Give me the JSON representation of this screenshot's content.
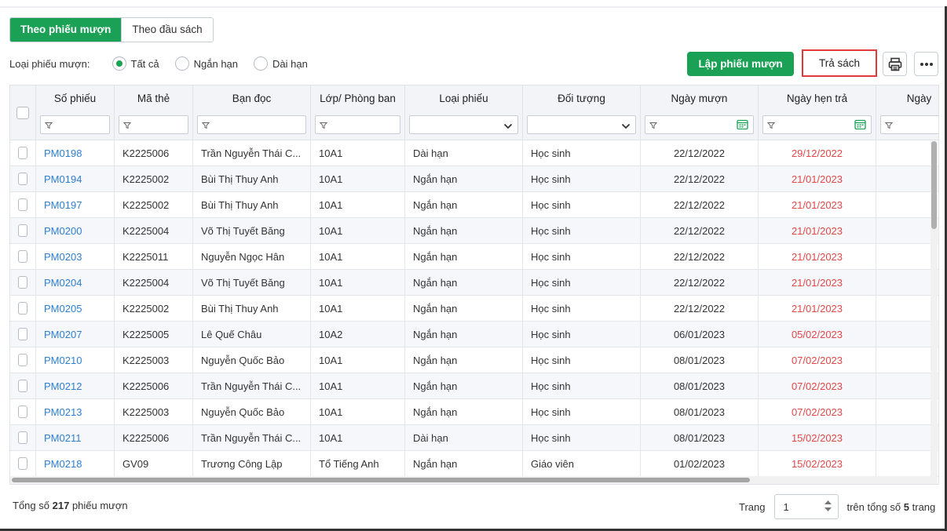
{
  "tabs": [
    {
      "label": "Theo phiếu mượn",
      "active": true
    },
    {
      "label": "Theo đầu sách",
      "active": false
    }
  ],
  "filter": {
    "label": "Loại phiếu mượn:",
    "options": [
      {
        "label": "Tất cả",
        "checked": true
      },
      {
        "label": "Ngắn hạn",
        "checked": false
      },
      {
        "label": "Dài hạn",
        "checked": false
      }
    ]
  },
  "toolbar": {
    "create_label": "Lập phiếu mượn",
    "return_label": "Trả sách",
    "print_icon": "printer-icon",
    "more_icon": "more-icon"
  },
  "colors": {
    "primary": "#1aa155",
    "link": "#2d7fd3",
    "due": "#e04848",
    "highlight": "#e03b3b"
  },
  "table": {
    "columns": [
      {
        "key": "select",
        "label": ""
      },
      {
        "key": "so_phieu",
        "label": "Số phiếu",
        "filter": "text"
      },
      {
        "key": "ma_the",
        "label": "Mã thẻ",
        "filter": "text"
      },
      {
        "key": "ban_doc",
        "label": "Bạn đọc",
        "filter": "text"
      },
      {
        "key": "lop",
        "label": "Lớp/ Phòng ban",
        "filter": "text"
      },
      {
        "key": "loai_phieu",
        "label": "Loại phiếu",
        "filter": "select"
      },
      {
        "key": "doi_tuong",
        "label": "Đối tượng",
        "filter": "select"
      },
      {
        "key": "ngay_muon",
        "label": "Ngày mượn",
        "filter": "date"
      },
      {
        "key": "ngay_hen_tra",
        "label": "Ngày hẹn trả",
        "filter": "date"
      },
      {
        "key": "ngay_tra",
        "label": "Ngày",
        "filter": "text"
      }
    ],
    "rows": [
      {
        "so_phieu": "PM0198",
        "ma_the": "K2225006",
        "ban_doc": "Trần Nguyễn Thái C...",
        "lop": "10A1",
        "loai_phieu": "Dài hạn",
        "doi_tuong": "Học sinh",
        "ngay_muon": "22/12/2022",
        "ngay_hen_tra": "29/12/2022"
      },
      {
        "so_phieu": "PM0194",
        "ma_the": "K2225002",
        "ban_doc": "Bùi Thị Thuy Anh",
        "lop": "10A1",
        "loai_phieu": "Ngắn hạn",
        "doi_tuong": "Học sinh",
        "ngay_muon": "22/12/2022",
        "ngay_hen_tra": "21/01/2023"
      },
      {
        "so_phieu": "PM0197",
        "ma_the": "K2225002",
        "ban_doc": "Bùi Thị Thuy Anh",
        "lop": "10A1",
        "loai_phieu": "Ngắn hạn",
        "doi_tuong": "Học sinh",
        "ngay_muon": "22/12/2022",
        "ngay_hen_tra": "21/01/2023"
      },
      {
        "so_phieu": "PM0200",
        "ma_the": "K2225004",
        "ban_doc": "Võ Thị Tuyết Băng",
        "lop": "10A1",
        "loai_phieu": "Ngắn hạn",
        "doi_tuong": "Học sinh",
        "ngay_muon": "22/12/2022",
        "ngay_hen_tra": "21/01/2023"
      },
      {
        "so_phieu": "PM0203",
        "ma_the": "K2225011",
        "ban_doc": "Nguyễn Ngọc Hân",
        "lop": "10A1",
        "loai_phieu": "Ngắn hạn",
        "doi_tuong": "Học sinh",
        "ngay_muon": "22/12/2022",
        "ngay_hen_tra": "21/01/2023"
      },
      {
        "so_phieu": "PM0204",
        "ma_the": "K2225004",
        "ban_doc": "Võ Thị Tuyết Băng",
        "lop": "10A1",
        "loai_phieu": "Ngắn hạn",
        "doi_tuong": "Học sinh",
        "ngay_muon": "22/12/2022",
        "ngay_hen_tra": "21/01/2023"
      },
      {
        "so_phieu": "PM0205",
        "ma_the": "K2225002",
        "ban_doc": "Bùi Thị Thuy Anh",
        "lop": "10A1",
        "loai_phieu": "Ngắn hạn",
        "doi_tuong": "Học sinh",
        "ngay_muon": "22/12/2022",
        "ngay_hen_tra": "21/01/2023"
      },
      {
        "so_phieu": "PM0207",
        "ma_the": "K2225005",
        "ban_doc": "Lê Quế Châu",
        "lop": "10A2",
        "loai_phieu": "Ngắn hạn",
        "doi_tuong": "Học sinh",
        "ngay_muon": "06/01/2023",
        "ngay_hen_tra": "05/02/2023"
      },
      {
        "so_phieu": "PM0210",
        "ma_the": "K2225003",
        "ban_doc": "Nguyễn Quốc Bảo",
        "lop": "10A1",
        "loai_phieu": "Ngắn hạn",
        "doi_tuong": "Học sinh",
        "ngay_muon": "08/01/2023",
        "ngay_hen_tra": "07/02/2023"
      },
      {
        "so_phieu": "PM0212",
        "ma_the": "K2225006",
        "ban_doc": "Trần Nguyễn Thái C...",
        "lop": "10A1",
        "loai_phieu": "Ngắn hạn",
        "doi_tuong": "Học sinh",
        "ngay_muon": "08/01/2023",
        "ngay_hen_tra": "07/02/2023"
      },
      {
        "so_phieu": "PM0213",
        "ma_the": "K2225003",
        "ban_doc": "Nguyễn Quốc Bảo",
        "lop": "10A1",
        "loai_phieu": "Ngắn hạn",
        "doi_tuong": "Học sinh",
        "ngay_muon": "08/01/2023",
        "ngay_hen_tra": "07/02/2023"
      },
      {
        "so_phieu": "PM0211",
        "ma_the": "K2225006",
        "ban_doc": "Trần Nguyễn Thái C...",
        "lop": "10A1",
        "loai_phieu": "Dài hạn",
        "doi_tuong": "Học sinh",
        "ngay_muon": "08/01/2023",
        "ngay_hen_tra": "15/02/2023"
      },
      {
        "so_phieu": "PM0218",
        "ma_the": "GV09",
        "ban_doc": "Trương Công Lập",
        "lop": "Tổ Tiếng Anh",
        "loai_phieu": "Ngắn hạn",
        "doi_tuong": "Giáo viên",
        "ngay_muon": "01/02/2023",
        "ngay_hen_tra": "15/02/2023"
      }
    ]
  },
  "footer": {
    "total_prefix": "Tổng số",
    "total_count": "217",
    "total_suffix": "phiếu mượn",
    "page_label": "Trang",
    "page_value": "1",
    "of_label": "trên tổng số",
    "page_total": "5",
    "page_suffix": "trang"
  }
}
